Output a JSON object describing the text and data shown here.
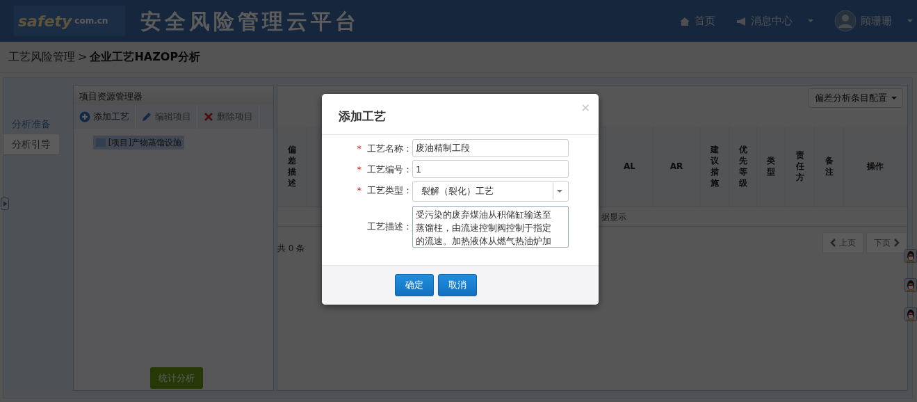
{
  "header": {
    "logo_text": "safety",
    "logo_domain": "com.cn",
    "title": "安全风险管理云平台",
    "nav": [
      {
        "label": "首页",
        "kind": "home",
        "dropdown": false
      },
      {
        "label": "消息中心",
        "kind": "messages",
        "dropdown": true
      },
      {
        "label": "顾珊珊",
        "kind": "user",
        "dropdown": true
      }
    ]
  },
  "breadcrumb": {
    "parent": "工艺风险管理",
    "separator": ">",
    "current": "企业工艺HAZOP分析"
  },
  "side_tabs": [
    {
      "label": "分析准备",
      "selected": false
    },
    {
      "label": "分析引导",
      "selected": true
    }
  ],
  "project_panel": {
    "title": "项目资源管理器",
    "toolbar": [
      {
        "label": "添加工艺",
        "kind": "add"
      },
      {
        "label": "编辑项目",
        "kind": "edit"
      },
      {
        "label": "删除项目",
        "kind": "delete"
      }
    ],
    "tree": [
      {
        "label": "[项目]产物蒸馏设施",
        "selected": true
      }
    ],
    "button": "统计分析"
  },
  "analysis_panel": {
    "config_button": "偏差分析条目配置",
    "columns": [
      {
        "label": "偏差描述",
        "kind": "vertical"
      },
      {
        "label": "AL",
        "kind": "horizontal"
      },
      {
        "label": "AR",
        "kind": "horizontal"
      },
      {
        "label": "建议措施",
        "kind": "vertical"
      },
      {
        "label": "优先等级",
        "kind": "vertical"
      },
      {
        "label": "类型",
        "kind": "vertical"
      },
      {
        "label": "责任方",
        "kind": "vertical"
      },
      {
        "label": "备注",
        "kind": "vertical"
      },
      {
        "label": "操作",
        "kind": "horizontal"
      }
    ],
    "empty_text": "据显示",
    "total": "共 0 条",
    "pager": [
      {
        "label": "上页",
        "kind": "prev",
        "disabled": true
      },
      {
        "label": "下页",
        "kind": "next",
        "disabled": true
      }
    ]
  },
  "dialog": {
    "title": "添加工艺",
    "close": "×",
    "required_mark": "*",
    "fields": [
      {
        "label": "工艺名称：",
        "required": true,
        "kind": "text",
        "value": "废油精制工段"
      },
      {
        "label": "工艺编号：",
        "required": true,
        "kind": "text",
        "value": "1"
      },
      {
        "label": "工艺类型：",
        "required": true,
        "kind": "select",
        "value": "裂解（裂化）工艺"
      },
      {
        "label": "工艺描述：",
        "required": false,
        "kind": "textarea",
        "value": "受污染的废弃煤油从积储缸输送至蒸馏柱，由流速控制阀控制于指定的流速。加热液体从燃气热油炉加"
      }
    ],
    "buttons": [
      {
        "label": "确定"
      },
      {
        "label": "取消"
      }
    ]
  }
}
